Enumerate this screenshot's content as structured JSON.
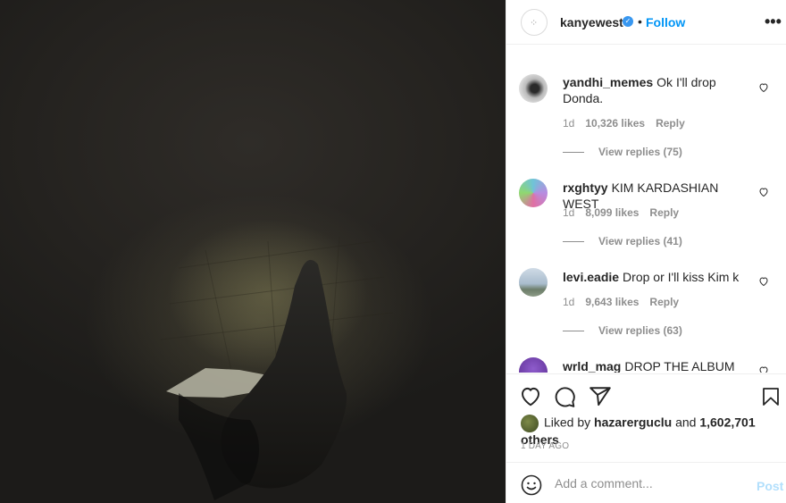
{
  "post": {
    "author": "kanyewest",
    "follow_label": "Follow",
    "separator": "•",
    "more_label": "•••",
    "verified_glyph": "✓",
    "avatar_glyph": "⁘"
  },
  "comments": [
    {
      "username": "yandhi_memes",
      "text": "Ok I'll drop Donda.",
      "age": "1d",
      "likes": "10,326 likes",
      "reply_label": "Reply",
      "view_replies": "View replies (75)",
      "avatar_color": "#bbbbbb"
    },
    {
      "username": "rxghtyy",
      "text": "KIM KARDASHIAN WEST",
      "age": "1d",
      "likes": "8,099 likes",
      "reply_label": "Reply",
      "view_replies": "View replies (41)",
      "avatar_color": "#9b8fd8"
    },
    {
      "username": "levi.eadie",
      "text": "Drop or I'll kiss Kim k",
      "age": "1d",
      "likes": "9,643 likes",
      "reply_label": "Reply",
      "view_replies": "View replies (63)",
      "avatar_color": "#9fb5c8"
    },
    {
      "username": "wrld_mag",
      "text": "DROP THE ALBUM",
      "avatar_color": "#6b3fa0"
    }
  ],
  "actions": {
    "liked_by_prefix": "Liked by",
    "liked_by_user": "hazarerguclu",
    "liked_by_and": "and",
    "liked_by_others": "1,602,701 others",
    "time_ago": "1 DAY AGO"
  },
  "add_comment": {
    "placeholder": "Add a comment...",
    "post_label": "Post"
  },
  "icons": [
    "heart-icon",
    "comment-icon",
    "share-icon",
    "bookmark-icon",
    "emoji-icon",
    "verified-badge-icon",
    "more-options-icon"
  ],
  "colors": {
    "accent": "#0095f6",
    "muted": "#8e8e8e",
    "post_disabled": "#b2dffc"
  }
}
